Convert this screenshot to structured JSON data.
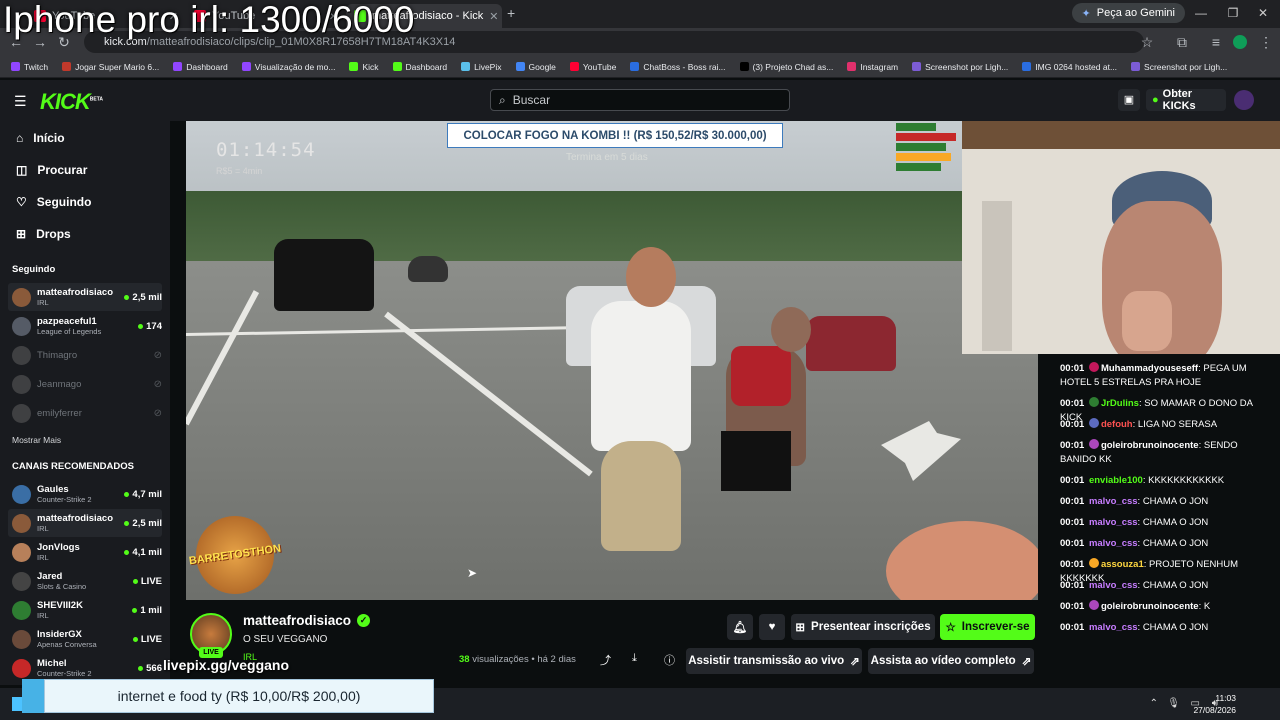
{
  "overlay_title": "Iphone pro irl: 1300/6000",
  "browser": {
    "tabs": [
      {
        "label": "YouTube"
      },
      {
        "label": "YouTube"
      },
      {
        "label": "matteafrodisiaco - Kick"
      }
    ],
    "new_tab": "+",
    "gemini": "Peça ao Gemini",
    "url_host": "kick.com",
    "url_path": "/matteafrodisiaco/clips/clip_01M0X8R17658H7TM18AT4K3X14",
    "bookmarks": [
      {
        "label": "Twitch",
        "color": "#9146ff"
      },
      {
        "label": "Jogar Super Mario 6...",
        "color": "#c0392b"
      },
      {
        "label": "Dashboard",
        "color": "#9146ff"
      },
      {
        "label": "Visualização de mo...",
        "color": "#9146ff"
      },
      {
        "label": "Kick",
        "color": "#53fc18"
      },
      {
        "label": "Dashboard",
        "color": "#53fc18"
      },
      {
        "label": "LivePix",
        "color": "#5bc0eb"
      },
      {
        "label": "Google",
        "color": "#4285f4"
      },
      {
        "label": "YouTube",
        "color": "#ff0033"
      },
      {
        "label": "ChatBoss - Boss rai...",
        "color": "#2a6de0"
      },
      {
        "label": "(3) Projeto Chad as...",
        "color": "#000000"
      },
      {
        "label": "Instagram",
        "color": "#e1306c"
      },
      {
        "label": "Screenshot por Ligh...",
        "color": "#7c5cd6"
      },
      {
        "label": "IMG 0264 hosted at...",
        "color": "#2a6de0"
      },
      {
        "label": "Screenshot por Ligh...",
        "color": "#7c5cd6"
      }
    ]
  },
  "header": {
    "logo": "KICK",
    "logo_badge": "BETA",
    "search_placeholder": "Buscar",
    "get_kicks": "Obter KICKs"
  },
  "sidebar": {
    "nav": [
      {
        "label": "Início",
        "icon": "home-icon"
      },
      {
        "label": "Procurar",
        "icon": "browse-icon"
      },
      {
        "label": "Seguindo",
        "icon": "heart-icon"
      },
      {
        "label": "Drops",
        "icon": "gift-icon"
      }
    ],
    "following_header": "Seguindo",
    "following": [
      {
        "name": "matteafrodisiaco",
        "category": "IRL",
        "viewers": "2,5 mil",
        "online": true,
        "color": "#8a5a3a"
      },
      {
        "name": "pazpeaceful1",
        "category": "League of Legends",
        "viewers": "174",
        "online": true,
        "color": "#555b66"
      },
      {
        "name": "Thimagro",
        "category": "",
        "viewers": "",
        "online": false,
        "color": "#777"
      },
      {
        "name": "Jeanmago",
        "category": "",
        "viewers": "",
        "online": false,
        "color": "#777"
      },
      {
        "name": "emilyferrer",
        "category": "",
        "viewers": "",
        "online": false,
        "color": "#777"
      }
    ],
    "show_more": "Mostrar Mais",
    "recommended_header": "CANAIS RECOMENDADOS",
    "recommended": [
      {
        "name": "Gaules",
        "category": "Counter-Strike 2",
        "viewers": "4,7 mil",
        "color": "#3a6ea5"
      },
      {
        "name": "matteafrodisiaco",
        "category": "IRL",
        "viewers": "2,5 mil",
        "color": "#8a5a3a"
      },
      {
        "name": "JonVlogs",
        "category": "IRL",
        "viewers": "4,1 mil",
        "color": "#b7805a"
      },
      {
        "name": "Jared",
        "category": "Slots & Casino",
        "viewers": "LIVE",
        "color": "#444"
      },
      {
        "name": "SHEVIII2K",
        "category": "IRL",
        "viewers": "1 mil",
        "color": "#2e7d32"
      },
      {
        "name": "InsiderGX",
        "category": "Apenas Conversa",
        "viewers": "LIVE",
        "color": "#6a4a3a"
      },
      {
        "name": "Michel",
        "category": "Counter-Strike 2",
        "viewers": "566",
        "color": "#c62828"
      }
    ]
  },
  "video": {
    "timer": "01:14:54",
    "timer_sub": "R$5 = 4min",
    "goal": "COLOCAR FOGO NA KOMBI !! (R$ 150,52/R$ 30.000,00)",
    "goal_sub": "Termina em 5 dias",
    "badge_text": "BARRETOSTHON"
  },
  "chat": [
    {
      "time": "00:01",
      "user": "Muhammadyouseseff",
      "text": ": PEGA UM HOTEL 5 ESTRELAS PRA HOJE",
      "color": "#ffffff",
      "badge": "#c2185b"
    },
    {
      "time": "00:01",
      "user": "JrDulins",
      "text": ": SO MAMAR O DONO DA KICK",
      "color": "#53fc18",
      "badge": "#2e7d32"
    },
    {
      "time": "00:01",
      "user": "defouh",
      "text": ": LIGA NO SERASA",
      "color": "#ff5252",
      "badge": "#5c6bc0"
    },
    {
      "time": "00:01",
      "user": "goleirobrunoinocente",
      "text": ": SENDO BANIDO KK",
      "color": "#ffffff",
      "badge": "#ab47bc"
    },
    {
      "time": "00:01",
      "user": "enviable100",
      "text": ": KKKKKKKKKKKK",
      "color": "#53fc18",
      "badge": ""
    },
    {
      "time": "00:01",
      "user": "malvo_css",
      "text": ": CHAMA O JON",
      "color": "#c77dff",
      "badge": ""
    },
    {
      "time": "00:01",
      "user": "malvo_css",
      "text": ": CHAMA O JON",
      "color": "#c77dff",
      "badge": ""
    },
    {
      "time": "00:01",
      "user": "malvo_css",
      "text": ": CHAMA O JON",
      "color": "#c77dff",
      "badge": ""
    },
    {
      "time": "00:01",
      "user": "assouza1",
      "text": ": PROJETO NENHUM KKKKKKK",
      "color": "#ffd740",
      "badge": "#f9a825"
    },
    {
      "time": "00:01",
      "user": "malvo_css",
      "text": ": CHAMA O JON",
      "color": "#c77dff",
      "badge": ""
    },
    {
      "time": "00:01",
      "user": "goleirobrunoinocente",
      "text": ": K",
      "color": "#ffffff",
      "badge": "#ab47bc"
    },
    {
      "time": "00:01",
      "user": "malvo_css",
      "text": ": CHAMA O JON",
      "color": "#c77dff",
      "badge": ""
    }
  ],
  "channel": {
    "name": "matteafrodisiaco",
    "title": "O SEU VEGGANO",
    "category": "IRL",
    "live_badge": "LIVE",
    "livepix": "livepix.gg/veggano",
    "views_count": "38",
    "views_label": " visualizações",
    "age": "• há 2 dias"
  },
  "actions": {
    "gift": "Presentear inscrições",
    "subscribe": "Inscrever-se",
    "watch_live": "Assistir transmissão ao vivo",
    "watch_full": "Assista ao vídeo completo"
  },
  "donation": "internet e food ty (R$ 10,00/R$ 200,00)",
  "taskbar": {
    "time": "11:03",
    "date": "27/08/2026"
  }
}
